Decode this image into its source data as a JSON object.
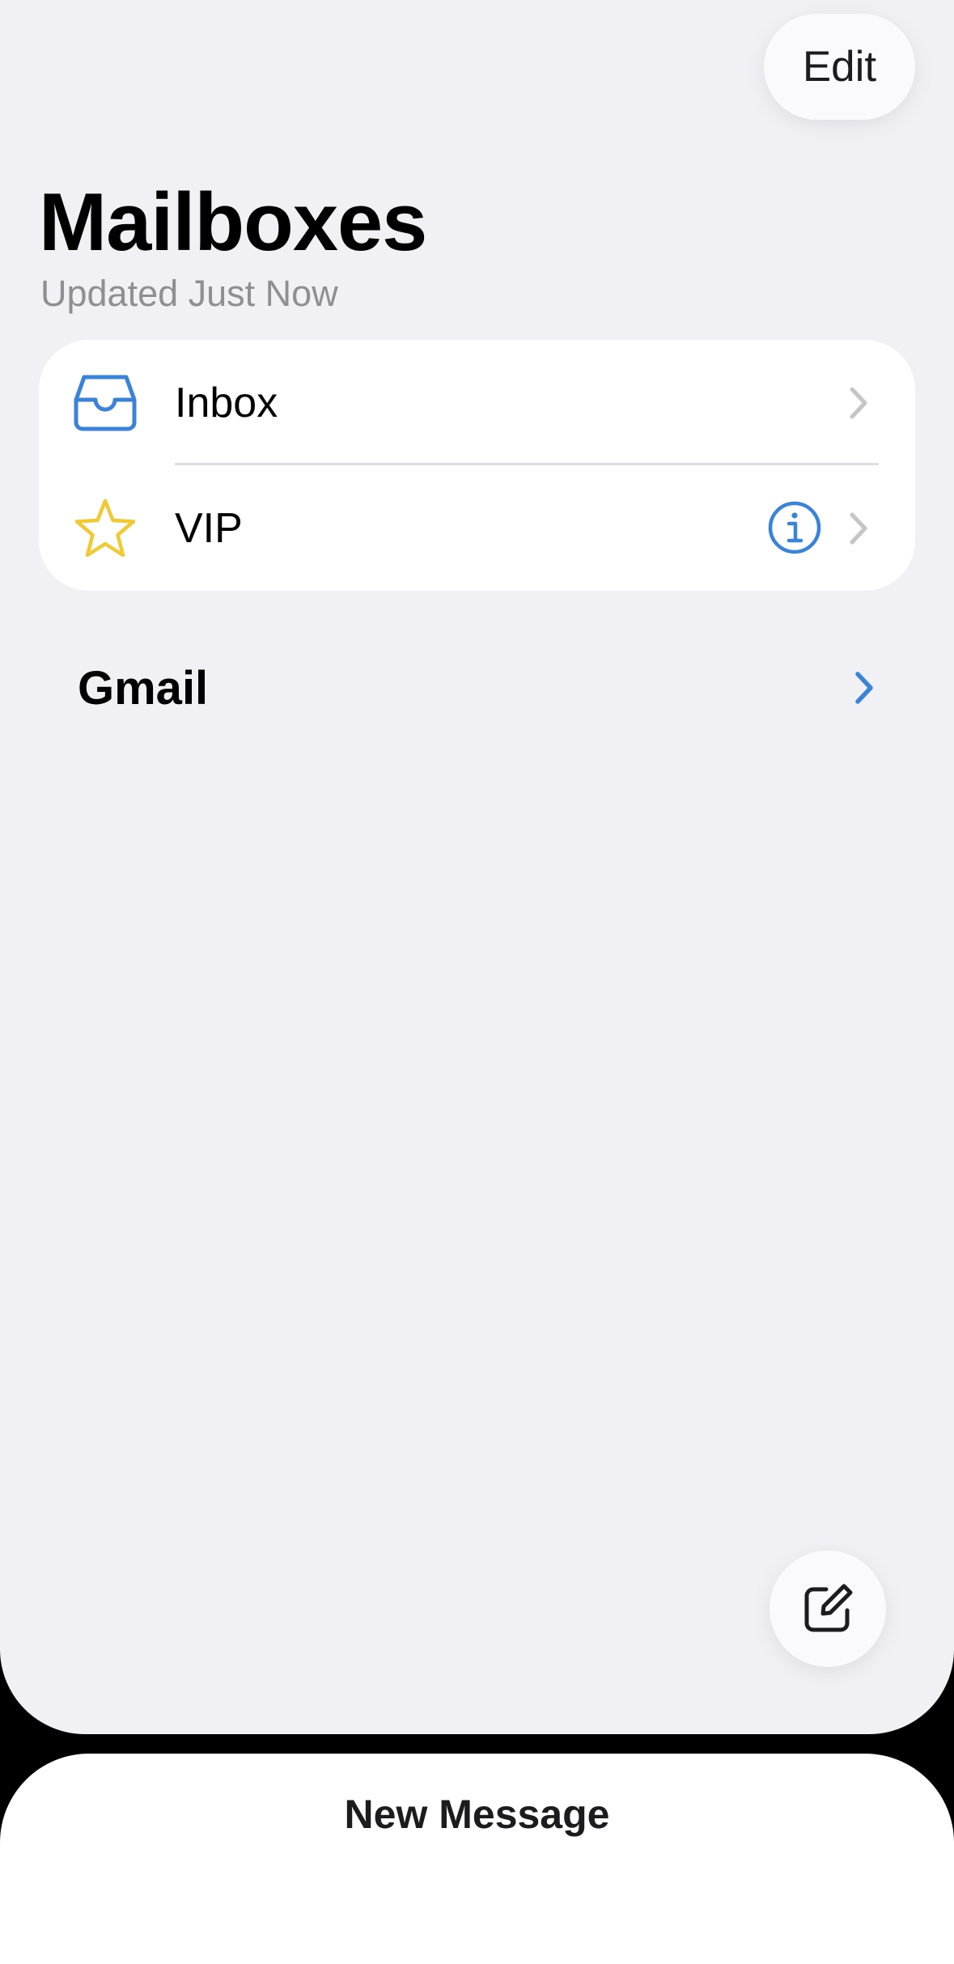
{
  "header": {
    "edit_label": "Edit",
    "title": "Mailboxes",
    "subtitle": "Updated Just Now"
  },
  "mailboxes": [
    {
      "label": "Inbox",
      "icon": "inbox-tray-icon",
      "accessory": "chevron-right-icon"
    },
    {
      "label": "VIP",
      "icon": "star-outline-icon",
      "accessory": "info-circle-icon"
    }
  ],
  "accounts": [
    {
      "label": "Gmail",
      "expanded": false,
      "accessory": "chevron-right-icon"
    }
  ],
  "toolbar": {
    "compose_icon": "compose-icon"
  },
  "sheet": {
    "title": "New Message"
  },
  "colors": {
    "accent": "#3b82d9",
    "star": "#f0c935",
    "background": "#f0f0f5",
    "card": "#ffffff",
    "secondary_text": "#8e8e93"
  }
}
